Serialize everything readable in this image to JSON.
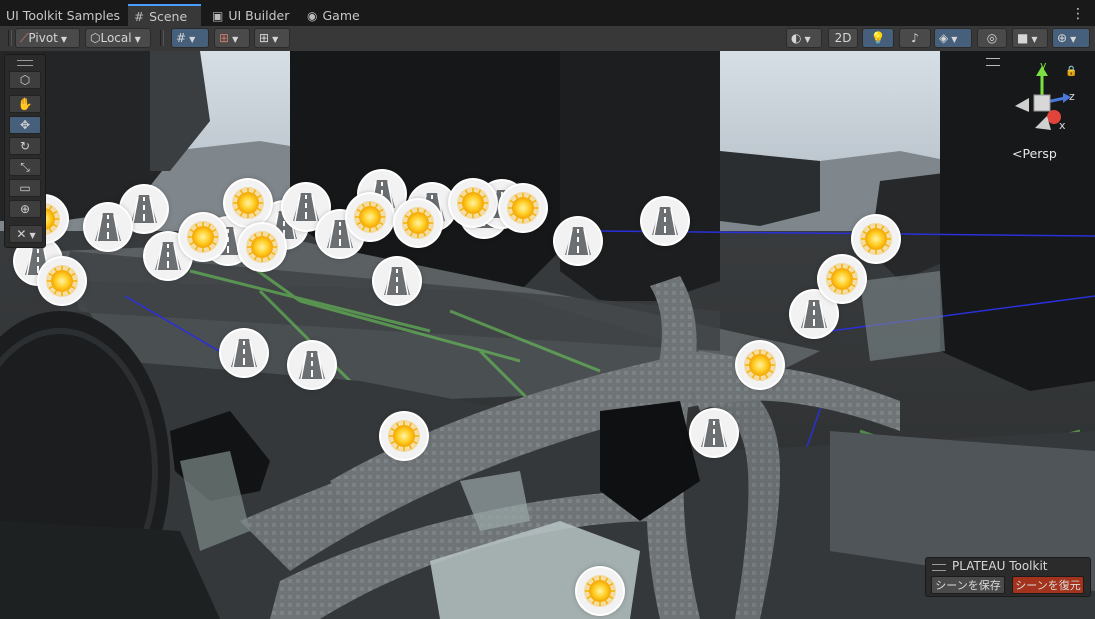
{
  "tabs": {
    "project": "UI Toolkit Samples",
    "scene": "Scene",
    "ui_builder": "UI Builder",
    "game": "Game"
  },
  "toolbar": {
    "pivot": "Pivot",
    "local": "Local",
    "two_d": "2D"
  },
  "view": {
    "persp": "Persp",
    "axis_x": "x",
    "axis_y": "y",
    "axis_z": "z"
  },
  "plateau": {
    "title": "PLATEAU Toolkit",
    "save_button": "シーンを保存",
    "restore_button": "シーンを復元"
  },
  "colors": {
    "accent": "#4a9cff",
    "restore_button_bg": "#a3331c",
    "sun_marker": "#f5b400"
  },
  "icons": {
    "sun_marker": "sun-icon",
    "road_marker": "road-icon"
  }
}
